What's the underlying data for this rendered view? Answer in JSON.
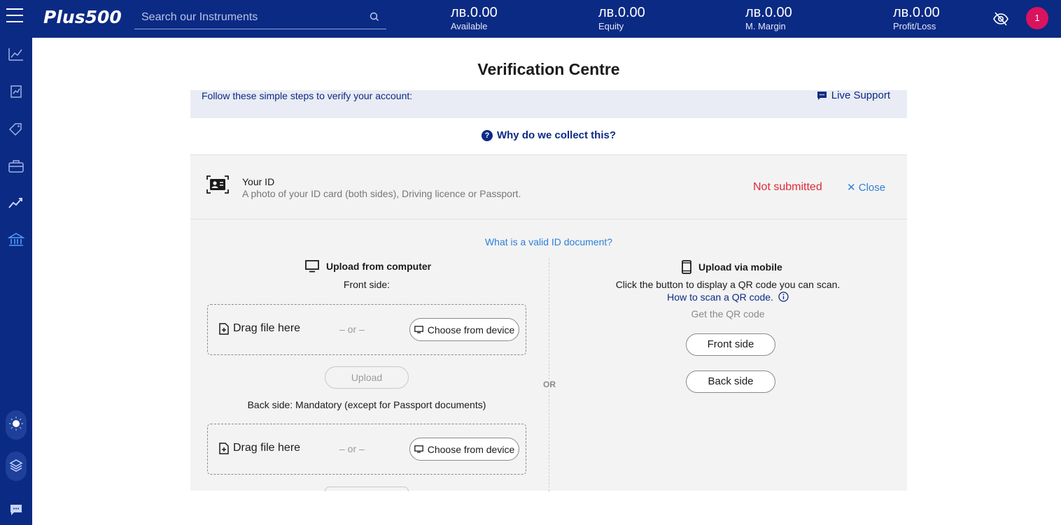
{
  "header": {
    "logo": "Plus500",
    "search_placeholder": "Search our Instruments",
    "stats": [
      {
        "value": "лв.0.00",
        "label": "Available"
      },
      {
        "value": "лв.0.00",
        "label": "Equity"
      },
      {
        "value": "лв.0.00",
        "label": "M. Margin"
      },
      {
        "value": "лв.0.00",
        "label": "Profit/Loss"
      }
    ],
    "notification_count": "1"
  },
  "page": {
    "title": "Verification Centre",
    "steps_text": "Follow these simple steps to verify your account:",
    "live_support": "Live Support",
    "why_collect": "Why do we collect this?"
  },
  "id_section": {
    "title": "Your ID",
    "description": "A photo of your ID card (both sides), Driving licence or Passport.",
    "status": "Not submitted",
    "close_label": "Close",
    "valid_link": "What is a valid ID document?"
  },
  "computer_upload": {
    "heading": "Upload from computer",
    "front_label": "Front side:",
    "back_label": "Back side: Mandatory (except for Passport documents)",
    "drag_text": "Drag file here",
    "or_text": "– or –",
    "choose_label": "Choose from device",
    "upload_label": "Upload"
  },
  "or_separator": "OR",
  "mobile_upload": {
    "heading": "Upload via mobile",
    "instruction": "Click the button to display a QR code you can scan.",
    "how_link": "How to scan a QR code.",
    "get_qr": "Get the QR code",
    "front_button": "Front side",
    "back_button": "Back side"
  },
  "colors": {
    "brand_navy": "#0b2a84",
    "status_red": "#e0283a",
    "link_blue": "#2e7fd6",
    "badge_pink": "#d9135d"
  }
}
